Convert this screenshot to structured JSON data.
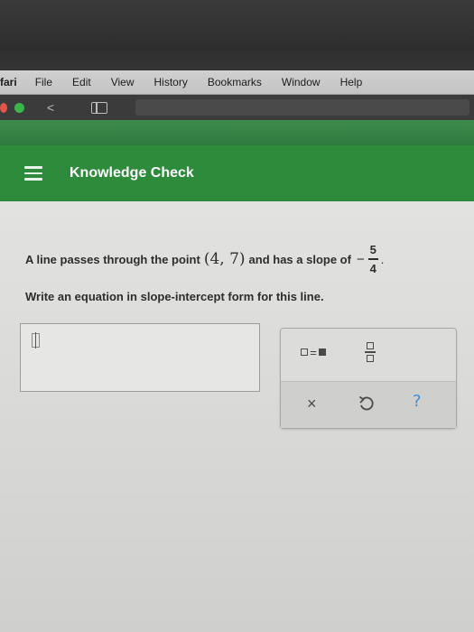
{
  "menubar": {
    "app_name": "fari",
    "items": [
      "File",
      "Edit",
      "View",
      "History",
      "Bookmarks",
      "Window",
      "Help"
    ]
  },
  "toolbar": {
    "back_label": "<"
  },
  "header": {
    "title": "Knowledge Check"
  },
  "question": {
    "prefix": "A line passes through the point",
    "point": "(4, 7)",
    "middle": "and has a slope of",
    "sign": "−",
    "slope_numerator": "5",
    "slope_denominator": "4",
    "period": ".",
    "instruction": "Write an equation in slope-intercept form for this line."
  },
  "answer": {
    "value": ""
  },
  "keypad": {
    "equals_label": "=",
    "clear_label": "×",
    "help_label": "?"
  },
  "colors": {
    "header_green": "#2e8b3c",
    "help_blue": "#3d8fd0"
  }
}
